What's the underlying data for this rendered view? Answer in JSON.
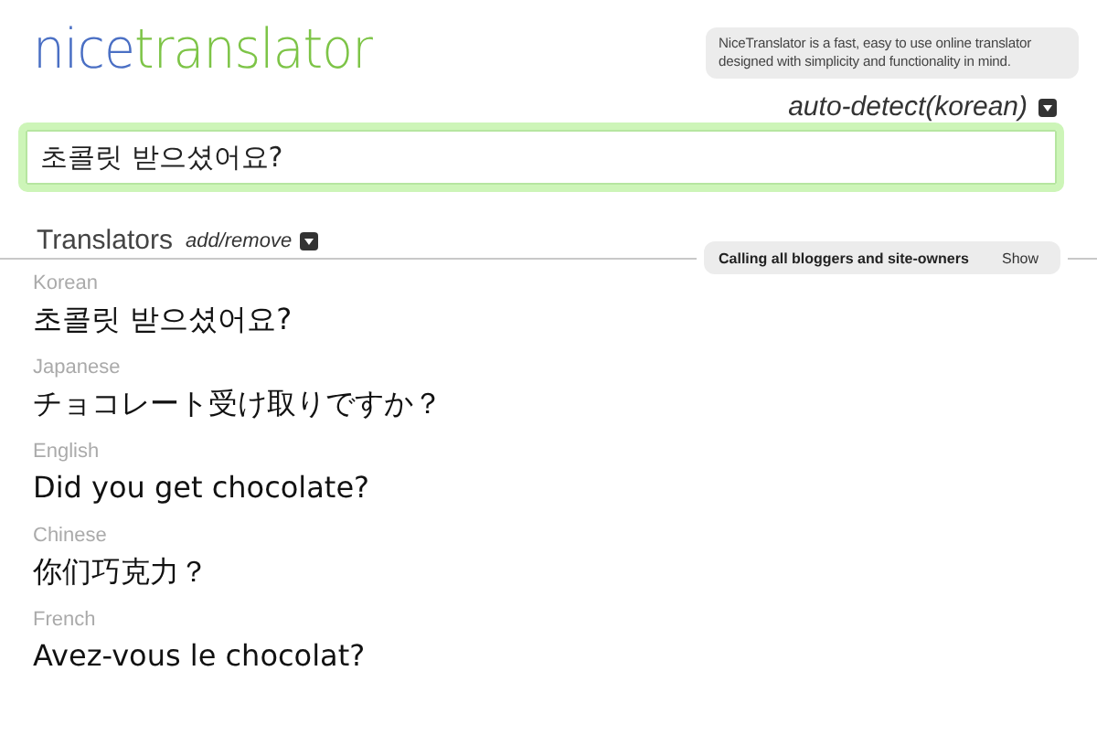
{
  "logo": {
    "first": "nice",
    "second": "translator"
  },
  "info": "NiceTranslator is a fast, easy to use online translator designed with simplicity and functionality in mind.",
  "source_language": "auto-detect(korean)",
  "input": {
    "value": "초콜릿 받으셨어요?"
  },
  "translators": {
    "title": "Translators",
    "toggle": "add/remove"
  },
  "banner": {
    "text": "Calling all bloggers and site-owners",
    "action": "Show"
  },
  "results": [
    {
      "language": "Korean",
      "text": "초콜릿 받으셨어요?"
    },
    {
      "language": "Japanese",
      "text": "チョコレート受け取りですか？"
    },
    {
      "language": "English",
      "text": "Did you get chocolate?"
    },
    {
      "language": "Chinese",
      "text": "你们巧克力？"
    },
    {
      "language": "French",
      "text": "Avez-vous le chocolat?"
    }
  ]
}
